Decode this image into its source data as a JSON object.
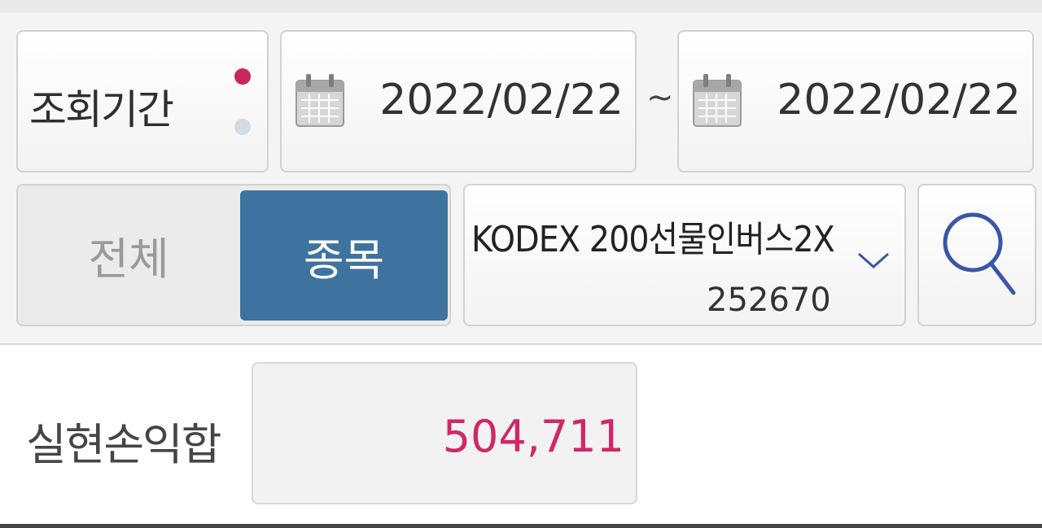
{
  "period": {
    "label": "조회기간",
    "start_date": "2022/02/22",
    "separator": "~",
    "end_date": "2022/02/22"
  },
  "filter": {
    "all_label": "전체",
    "item_label": "종목",
    "selected": "종목"
  },
  "stock": {
    "name": "KODEX 200선물인버스2X",
    "code": "252670"
  },
  "result": {
    "label": "실현손익합",
    "value": "504,711"
  },
  "icons": {
    "calendar": "calendar-icon",
    "dropdown": "chevron-down-icon",
    "search": "search-icon"
  },
  "colors": {
    "accent_blue": "#3e73a0",
    "profit_pink": "#d02865",
    "active_dot": "#c8285a",
    "inactive_dot": "#d5dbe4",
    "icon_blue": "#3b56a8"
  }
}
